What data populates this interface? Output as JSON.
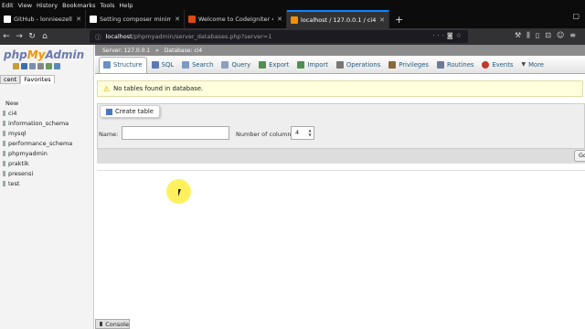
{
  "menubar": {
    "items": [
      "Edit",
      "View",
      "History",
      "Bookmarks",
      "Tools",
      "Help"
    ]
  },
  "tabs": [
    {
      "title": "GitHub - lonnieezell/myth-auth",
      "favicon_color": "#ffffff",
      "active": false
    },
    {
      "title": "Setting composer minimum st",
      "favicon_color": "#ffffff",
      "active": false
    },
    {
      "title": "Welcome to CodeIgniter 4!",
      "favicon_color": "#dd4814",
      "active": false
    },
    {
      "title": "localhost / 127.0.0.1 / ci4 | php",
      "favicon_color": "#f39200",
      "active": true
    }
  ],
  "navbar": {
    "url_host": "localhost",
    "url_path": "/phpmyadmin/server_databases.php?server=1"
  },
  "pma": {
    "logo_php": "php",
    "logo_my": "My",
    "logo_admin": "Admin",
    "left_tabs": [
      "cent",
      "Favorites"
    ],
    "databases": [
      "New",
      "ci4",
      "information_schema",
      "mysql",
      "performance_schema",
      "phpmyadmin",
      "praktik",
      "presensi",
      "test"
    ],
    "breadcrumb": {
      "server": "Server: 127.0.0.1",
      "arrow": "»",
      "database": "Database: ci4"
    },
    "top_menu": [
      {
        "label": "Structure",
        "icon": "structure-icon",
        "color": "#6a8fc9"
      },
      {
        "label": "SQL",
        "icon": "sql-icon",
        "color": "#5a7ab5"
      },
      {
        "label": "Search",
        "icon": "search-icon",
        "color": "#7a9bc4"
      },
      {
        "label": "Query",
        "icon": "query-icon",
        "color": "#8aa0c0"
      },
      {
        "label": "Export",
        "icon": "export-icon",
        "color": "#4f8f4f"
      },
      {
        "label": "Import",
        "icon": "import-icon",
        "color": "#4f8f4f"
      },
      {
        "label": "Operations",
        "icon": "operations-icon",
        "color": "#777777"
      },
      {
        "label": "Privileges",
        "icon": "privileges-icon",
        "color": "#8a6a3a"
      },
      {
        "label": "Routines",
        "icon": "routines-icon",
        "color": "#6a7a9a"
      },
      {
        "label": "Events",
        "icon": "events-icon",
        "color": "#c0392b"
      },
      {
        "label": "More",
        "icon": "chevron-down-icon",
        "color": "#444444"
      }
    ],
    "notice": "No tables found in database.",
    "create_table": {
      "legend": "Create table",
      "name_label": "Name:",
      "name_value": "",
      "columns_label": "Number of columns:",
      "columns_value": "4",
      "go_label": "Go"
    },
    "console_label": "Console"
  },
  "colors": {
    "accent": "#0a84ff",
    "notice_bg": "#ffffdd",
    "cursor_highlight": "#ffec28"
  }
}
